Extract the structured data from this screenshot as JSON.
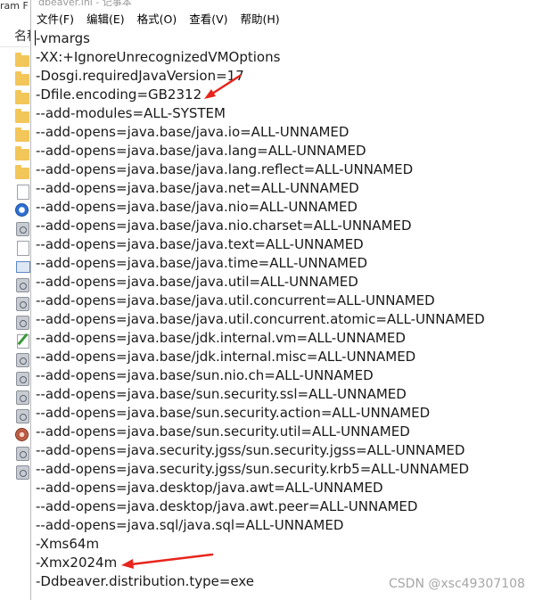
{
  "explorer": {
    "title_fragment": "ram F",
    "column_header": "名称"
  },
  "notepad": {
    "title": "dbeaver.ini - 记事本",
    "menu": [
      {
        "label": "文件(F)"
      },
      {
        "label": "编辑(E)"
      },
      {
        "label": "格式(O)"
      },
      {
        "label": "查看(V)"
      },
      {
        "label": "帮助(H)"
      }
    ],
    "lines": [
      "-vmargs",
      "-XX:+IgnoreUnrecognizedVMOptions",
      "-Dosgi.requiredJavaVersion=17",
      "-Dfile.encoding=GB2312",
      "--add-modules=ALL-SYSTEM",
      "--add-opens=java.base/java.io=ALL-UNNAMED",
      "--add-opens=java.base/java.lang=ALL-UNNAMED",
      "--add-opens=java.base/java.lang.reflect=ALL-UNNAMED",
      "--add-opens=java.base/java.net=ALL-UNNAMED",
      "--add-opens=java.base/java.nio=ALL-UNNAMED",
      "--add-opens=java.base/java.nio.charset=ALL-UNNAMED",
      "--add-opens=java.base/java.text=ALL-UNNAMED",
      "--add-opens=java.base/java.time=ALL-UNNAMED",
      "--add-opens=java.base/java.util=ALL-UNNAMED",
      "--add-opens=java.base/java.util.concurrent=ALL-UNNAMED",
      "--add-opens=java.base/java.util.concurrent.atomic=ALL-UNNAMED",
      "--add-opens=java.base/jdk.internal.vm=ALL-UNNAMED",
      "--add-opens=java.base/jdk.internal.misc=ALL-UNNAMED",
      "--add-opens=java.base/sun.nio.ch=ALL-UNNAMED",
      "--add-opens=java.base/sun.security.ssl=ALL-UNNAMED",
      "--add-opens=java.base/sun.security.action=ALL-UNNAMED",
      "--add-opens=java.base/sun.security.util=ALL-UNNAMED",
      "--add-opens=java.security.jgss/sun.security.jgss=ALL-UNNAMED",
      "--add-opens=java.security.jgss/sun.security.krb5=ALL-UNNAMED",
      "--add-opens=java.desktop/java.awt=ALL-UNNAMED",
      "--add-opens=java.desktop/java.awt.peer=ALL-UNNAMED",
      "--add-opens=java.sql/java.sql=ALL-UNNAMED",
      "-Xms64m",
      "-Xmx2024m",
      "-Ddbeaver.distribution.type=exe"
    ],
    "annotation_color": "#e8251c"
  },
  "watermark": "CSDN @xsc49307108"
}
